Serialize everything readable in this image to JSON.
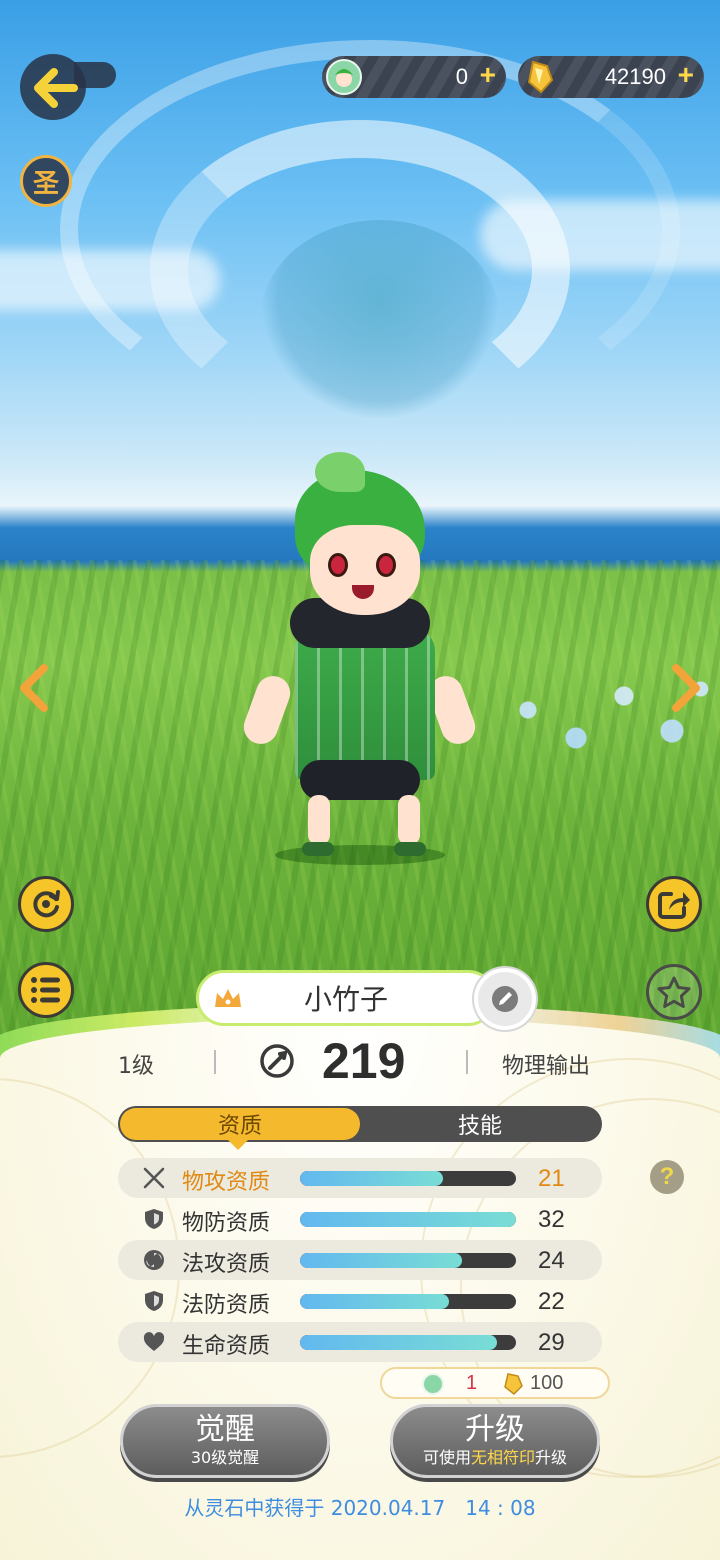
{
  "topbar": {
    "back_label": "",
    "holy_badge": "圣",
    "currency_1": {
      "value": "0",
      "plus": "+"
    },
    "currency_2": {
      "value": "42190",
      "plus": "+"
    }
  },
  "pet": {
    "name": "小竹子",
    "level": "1级",
    "power": "219",
    "role": "物理输出"
  },
  "tabs": [
    {
      "label": "资质",
      "active": true
    },
    {
      "label": "技能",
      "active": false
    }
  ],
  "attributes": [
    {
      "label": "物攻资质",
      "value": "21",
      "fill": 0.66,
      "icon": "swords-icon"
    },
    {
      "label": "物防资质",
      "value": "32",
      "fill": 1.0,
      "icon": "shield-icon"
    },
    {
      "label": "法攻资质",
      "value": "24",
      "fill": 0.75,
      "icon": "magic-swirl-icon"
    },
    {
      "label": "法防资质",
      "value": "22",
      "fill": 0.69,
      "icon": "shield-icon"
    },
    {
      "label": "生命资质",
      "value": "29",
      "fill": 0.91,
      "icon": "heart-icon"
    }
  ],
  "help_label": "?",
  "upgrade_cost": {
    "pet_count": "1",
    "crystal_count": "100"
  },
  "buttons": {
    "awaken_main": "觉醒",
    "awaken_sub": "30级觉醒",
    "upgrade_main": "升级",
    "upgrade_sub_pre": "可使用",
    "upgrade_sub_hl": "无相符印",
    "upgrade_sub_post": "升级"
  },
  "obtain_text": "从灵石中获得于 2020.04.17　14 : 08",
  "colors": {
    "accent": "#f5b92e",
    "highlight_text": "#e08a14",
    "bar_fill": "#79ddd5",
    "obtain_text": "#3e8de0"
  }
}
